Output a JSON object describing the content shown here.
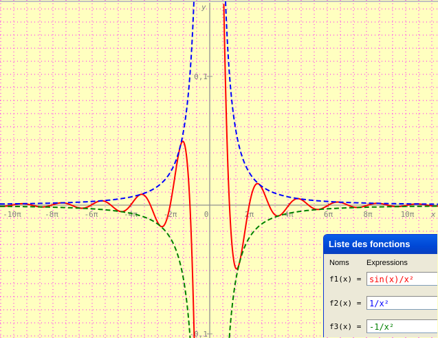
{
  "chart_data": {
    "type": "line",
    "title": "",
    "xlabel": "x",
    "ylabel": "y",
    "xlim_pi": [
      -10.6,
      11.7
    ],
    "ylim": [
      -0.1,
      0.16
    ],
    "x_ticks": [
      {
        "v": -10,
        "label": "-10π"
      },
      {
        "v": -8,
        "label": "-8π"
      },
      {
        "v": -6,
        "label": "-6π"
      },
      {
        "v": -4,
        "label": "-4π"
      },
      {
        "v": -2,
        "label": "-2π"
      },
      {
        "v": 0,
        "label": "0"
      },
      {
        "v": 2,
        "label": "2π"
      },
      {
        "v": 4,
        "label": "4π"
      },
      {
        "v": 6,
        "label": "6π"
      },
      {
        "v": 8,
        "label": "8π"
      },
      {
        "v": 10,
        "label": "10π"
      }
    ],
    "y_ticks": [
      {
        "v": 0.1,
        "label": "0,1"
      },
      {
        "v": -0.1,
        "label": "-0,1"
      }
    ],
    "grid": true,
    "series": [
      {
        "name": "f1",
        "expr": "sin(x)/x²",
        "color": "#ff0000",
        "dash": "solid"
      },
      {
        "name": "f2",
        "expr": "1/x²",
        "color": "#0000ff",
        "dash": "dashed"
      },
      {
        "name": "f3",
        "expr": "-1/x²",
        "color": "#008000",
        "dash": "dashed"
      }
    ]
  },
  "dialog": {
    "title": "Liste des fonctions",
    "col_names": "Noms",
    "col_expr": "Expressions",
    "rows": [
      {
        "name": "f1(x) =",
        "expr": "sin(x)/x²",
        "color": "#ff0000"
      },
      {
        "name": "f2(x) =",
        "expr": "1/x²",
        "color": "#0000ff"
      },
      {
        "name": "f3(x) =",
        "expr": "-1/x²",
        "color": "#008000"
      }
    ]
  }
}
